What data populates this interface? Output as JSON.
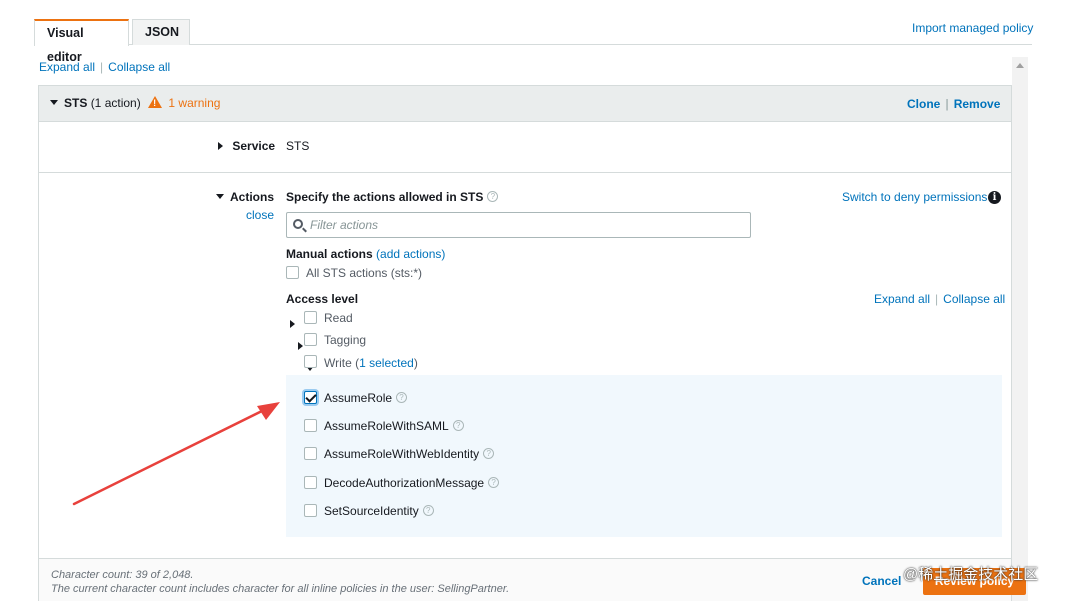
{
  "tabs": [
    {
      "label": "Visual editor",
      "active": true
    },
    {
      "label": "JSON",
      "active": false
    }
  ],
  "import_link": "Import managed policy",
  "top_controls": {
    "expand_all": "Expand all",
    "collapse_all": "Collapse all"
  },
  "header": {
    "service": "STS",
    "count": "(1 action)",
    "warning": "1 warning",
    "clone": "Clone",
    "remove": "Remove"
  },
  "service_row": {
    "label": "Service",
    "value": "STS"
  },
  "actions_row": {
    "label": "Actions",
    "close": "close",
    "title": "Specify the actions allowed in STS",
    "switch_deny": "Switch to deny permissions",
    "filter_placeholder": "Filter actions",
    "manual_actions_label": "Manual actions",
    "add_actions": "(add actions)",
    "all_actions": "All STS actions (sts:*)",
    "access_level_label": "Access level",
    "expand_all": "Expand all",
    "collapse_all": "Collapse all"
  },
  "access_levels": [
    {
      "label": "Read",
      "expanded": false
    },
    {
      "label": "Tagging",
      "expanded": false
    },
    {
      "label": "Write",
      "expanded": true,
      "selected_text": "1 selected"
    }
  ],
  "write_actions": [
    {
      "label": "AssumeRole",
      "checked": true
    },
    {
      "label": "AssumeRoleWithSAML",
      "checked": false
    },
    {
      "label": "AssumeRoleWithWebIdentity",
      "checked": false
    },
    {
      "label": "DecodeAuthorizationMessage",
      "checked": false
    },
    {
      "label": "SetSourceIdentity",
      "checked": false
    }
  ],
  "footer": {
    "char_count": "Character count: 39 of 2,048.",
    "note": "The current character count includes character for all inline policies in the user: SellingPartner.",
    "cancel": "Cancel",
    "review": "Review policy"
  },
  "watermark": "@稀土掘金技术社区",
  "colors": {
    "accent": "#ec7211",
    "link": "#0073bb",
    "arrow": "#e8413c"
  }
}
